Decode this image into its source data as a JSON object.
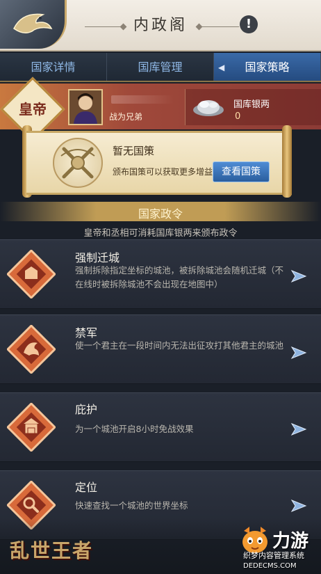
{
  "header": {
    "title": "内政阁",
    "help_icon": "exclamation-icon",
    "logo_icon": "dragon-icon"
  },
  "tabs": [
    {
      "label": "国家详情",
      "active": false
    },
    {
      "label": "国库管理",
      "active": false
    },
    {
      "label": "国家策略",
      "active": true
    }
  ],
  "emperor": {
    "seal_label": "皇帝",
    "player_title": "战为兄弟",
    "silver_label": "国库银两",
    "silver_value": "0"
  },
  "policy": {
    "title": "暂无国策",
    "description": "颁布国策可以获取更多增益",
    "button_label": "查看国策"
  },
  "section": {
    "title": "国家政令",
    "subtitle": "皇帝和丞相可消耗国库银两来颁布政令"
  },
  "decrees": [
    {
      "name": "强制迁城",
      "desc": "强制拆除指定坐标的城池，被拆除城池会随机迁城（不在线时被拆除城池不会出现在地图中）",
      "icon": "relocate-icon"
    },
    {
      "name": "禁军",
      "desc": "使一个君主在一段时间内无法出征攻打其他君主的城池",
      "icon": "griffin-icon"
    },
    {
      "name": "庇护",
      "desc": "为一个城池开启8小时免战效果",
      "icon": "shield-gate-icon"
    },
    {
      "name": "定位",
      "desc": "快速查找一个城池的世界坐标",
      "icon": "magnifier-icon"
    }
  ],
  "footer": {
    "game_logo": "乱世王者",
    "watermark_brand": "力游",
    "watermark_line1": "织梦内容管理系统",
    "watermark_line2": "DEDECMS.COM"
  },
  "colors": {
    "tab_active": "#2f5c96",
    "button_blue": "#3a74b8",
    "emperor_red": "#a0493a",
    "gold": "#c9a86a"
  }
}
